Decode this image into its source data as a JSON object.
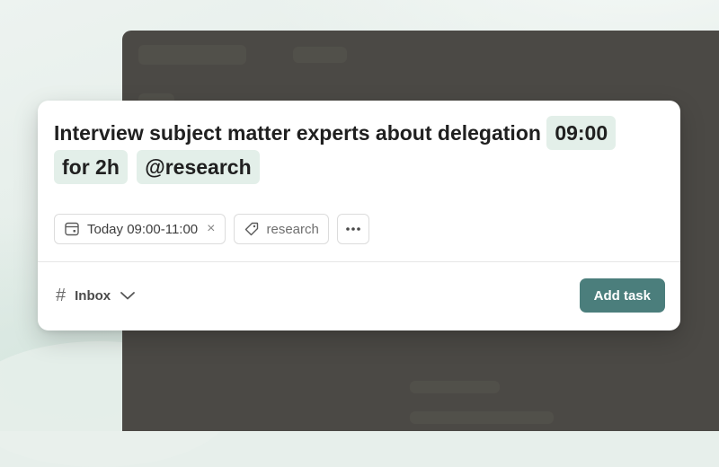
{
  "colors": {
    "accent": "#4b7e7c",
    "token_background": "#e3efe9",
    "overlay": "#4b4945"
  },
  "task": {
    "text": "Interview subject matter experts about delegation",
    "time_token": "09:00",
    "duration_token": "for 2h",
    "label_token": "@research"
  },
  "chips": {
    "date": {
      "icon": "calendar-icon",
      "label": "Today 09:00-11:00",
      "clear_icon": "close-icon",
      "clear": "×"
    },
    "label": {
      "icon": "tag-icon",
      "label": "research"
    },
    "more": {
      "icon": "more-icon",
      "label": "•••"
    }
  },
  "footer": {
    "project_icon": "hash-icon",
    "project_symbol": "#",
    "project_label": "Inbox",
    "project_dropdown_icon": "chevron-down-icon",
    "submit_label": "Add task"
  }
}
